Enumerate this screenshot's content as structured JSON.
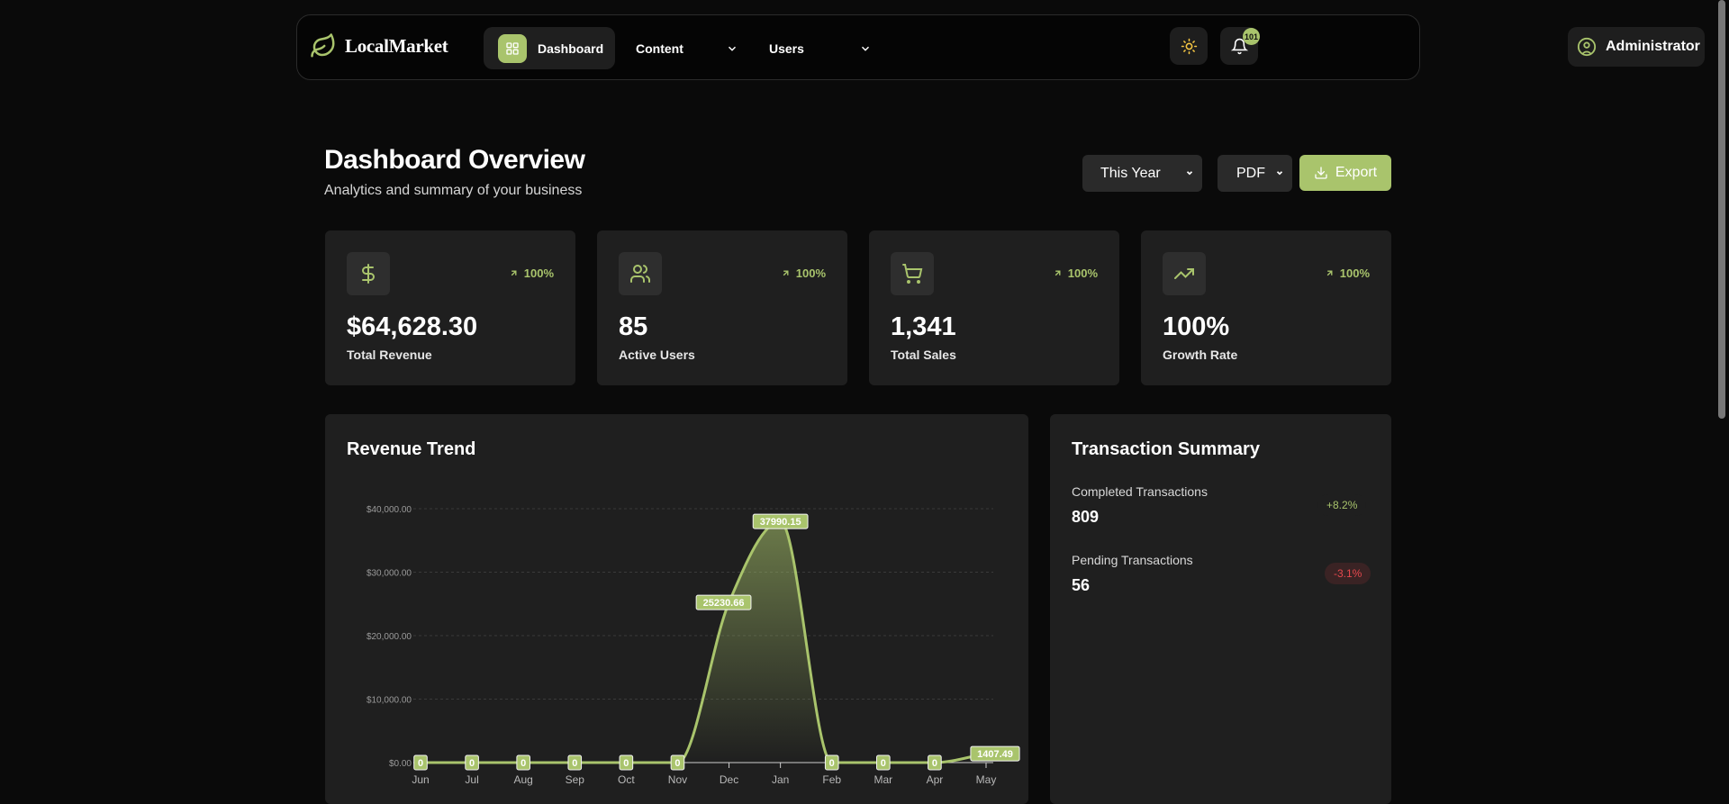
{
  "brand": {
    "name": "LocalMarket"
  },
  "nav": {
    "dashboard": "Dashboard",
    "content": "Content",
    "users": "Users",
    "notifications_count": "101",
    "user": "Administrator"
  },
  "header": {
    "title": "Dashboard Overview",
    "subtitle": "Analytics and summary of your business",
    "period": "This Year",
    "format": "PDF",
    "export": "Export"
  },
  "stats": [
    {
      "icon": "dollar-icon",
      "delta": "100%",
      "value": "$64,628.30",
      "label": "Total Revenue"
    },
    {
      "icon": "users-icon",
      "delta": "100%",
      "value": "85",
      "label": "Active Users"
    },
    {
      "icon": "cart-icon",
      "delta": "100%",
      "value": "1,341",
      "label": "Total Sales"
    },
    {
      "icon": "trending-up-icon",
      "delta": "100%",
      "value": "100%",
      "label": "Growth Rate"
    }
  ],
  "revenue_panel": {
    "title": "Revenue Trend"
  },
  "transactions": {
    "title": "Transaction Summary",
    "rows": [
      {
        "label": "Completed Transactions",
        "value": "809",
        "change": "+8.2%",
        "trend": "up"
      },
      {
        "label": "Pending Transactions",
        "value": "56",
        "change": "-3.1%",
        "trend": "down"
      }
    ]
  },
  "colors": {
    "accent": "#a9c46c",
    "bg": "#0a0a0a",
    "card": "#1f1f1f",
    "negative": "#e5484d"
  },
  "chart_data": {
    "type": "area",
    "title": "Revenue Trend",
    "categories": [
      "Jun",
      "Jul",
      "Aug",
      "Sep",
      "Oct",
      "Nov",
      "Dec",
      "Jan",
      "Feb",
      "Mar",
      "Apr",
      "May"
    ],
    "values": [
      0,
      0,
      0,
      0,
      0,
      0,
      25230.66,
      37990.15,
      0,
      0,
      0,
      1407.49
    ],
    "data_labels": [
      "0",
      "0",
      "0",
      "0",
      "0",
      "0",
      "25230.66",
      "37990.15",
      "0",
      "0",
      "0",
      "1407.49"
    ],
    "yticks": [
      0,
      10000,
      20000,
      30000,
      40000
    ],
    "ytick_labels": [
      "$0.00",
      "$10,000.00",
      "$20,000.00",
      "$30,000.00",
      "$40,000.00"
    ],
    "ylim": [
      0,
      40000
    ],
    "grid": true,
    "smooth": true
  }
}
